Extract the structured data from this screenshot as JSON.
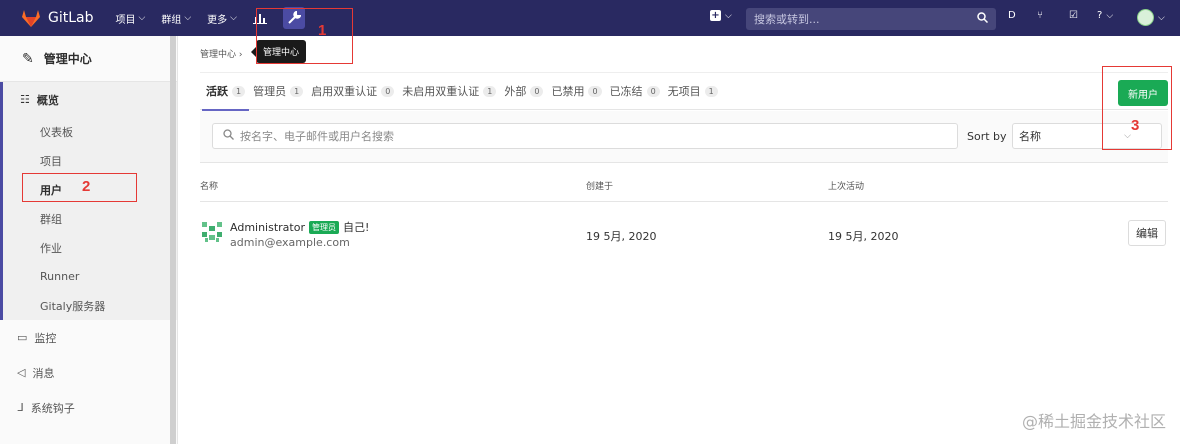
{
  "topbar": {
    "brand": "GitLab",
    "nav": [
      "项目",
      "群组",
      "更多"
    ],
    "search_placeholder": "搜索或转到...",
    "tooltip": "管理中心",
    "colors": {
      "bg": "#292961",
      "accent": "#fc6d26"
    }
  },
  "annotations": [
    "1",
    "2",
    "3"
  ],
  "sidebar": {
    "header": "管理中心",
    "overview": "概览",
    "overview_items": [
      "仪表板",
      "项目",
      "用户",
      "群组",
      "作业",
      "Runner",
      "Gitaly服务器"
    ],
    "bottom_items": [
      "监控",
      "消息",
      "系统钩子"
    ]
  },
  "breadcrumb": "管理中心 ›",
  "tabs": [
    {
      "label": "活跃",
      "count": "1"
    },
    {
      "label": "管理员",
      "count": "1"
    },
    {
      "label": "启用双重认证",
      "count": "0"
    },
    {
      "label": "未启用双重认证",
      "count": "1"
    },
    {
      "label": "外部",
      "count": "0"
    },
    {
      "label": "已禁用",
      "count": "0"
    },
    {
      "label": "已冻结",
      "count": "0"
    },
    {
      "label": "无项目",
      "count": "1"
    }
  ],
  "new_user_button": "新用户",
  "filter": {
    "placeholder": "按名字、电子邮件或用户名搜索",
    "sort_label": "Sort by",
    "sort_value": "名称"
  },
  "table": {
    "headers": [
      "名称",
      "创建于",
      "上次活动"
    ],
    "rows": [
      {
        "name": "Administrator",
        "badge": "管理员",
        "self": "自己!",
        "email": "admin@example.com",
        "created": "19 5月, 2020",
        "last_activity": "19 5月, 2020",
        "action": "编辑"
      }
    ]
  },
  "watermark": "@稀土掘金技术社区"
}
